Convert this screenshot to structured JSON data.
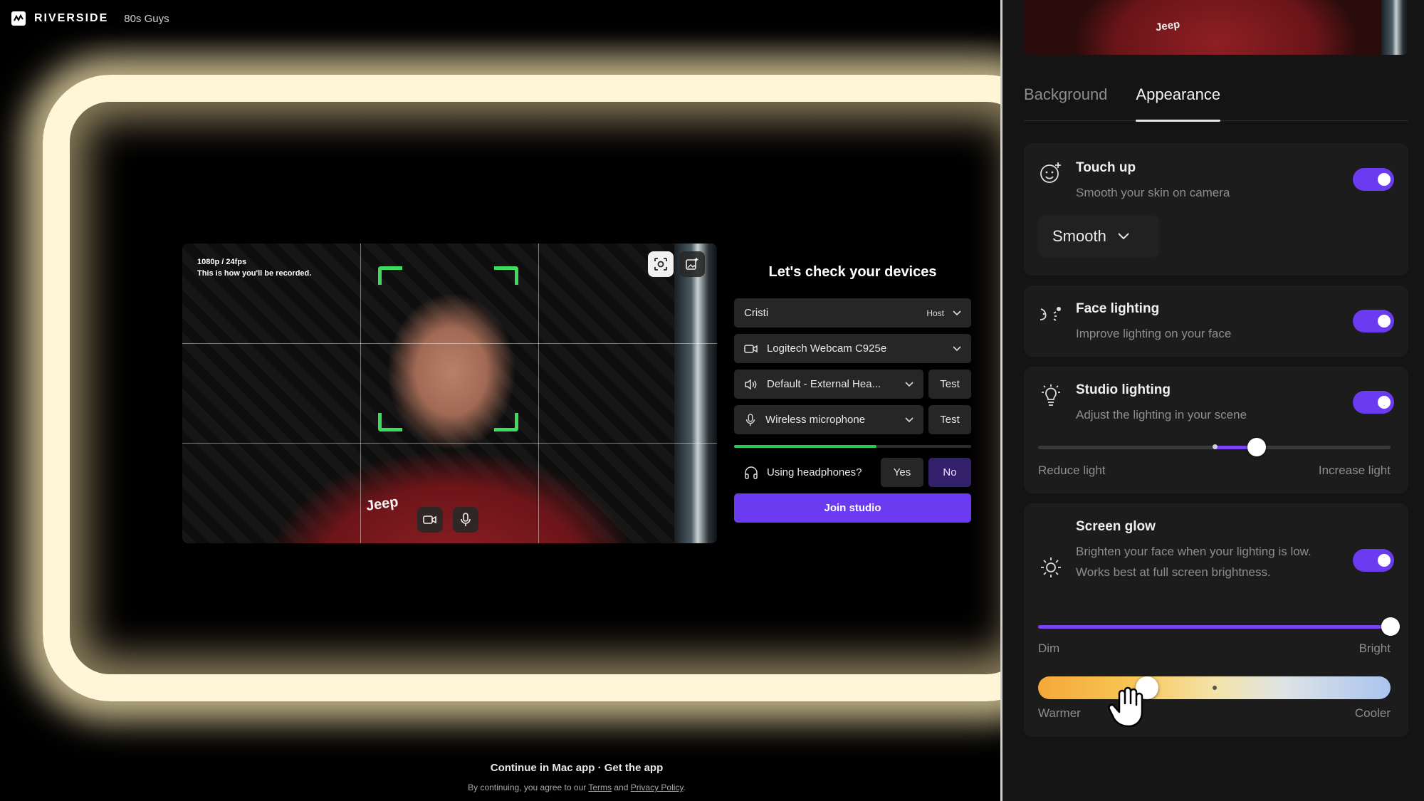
{
  "app": {
    "brand": "RIVERSIDE",
    "session_name": "80s Guys"
  },
  "preview": {
    "resolution": "1080p / 24fps",
    "note": "This is how you'll be recorded.",
    "shirt_logo": "Jeep"
  },
  "devices": {
    "title": "Let's check your devices",
    "name": "Cristi",
    "role": "Host",
    "camera": "Logitech Webcam C925e",
    "speaker": "Default - External Hea...",
    "microphone": "Wireless microphone",
    "test_label": "Test",
    "mic_level": 0.6,
    "headphones_question": "Using headphones?",
    "yes_label": "Yes",
    "no_label": "No",
    "join_label": "Join studio"
  },
  "footer": {
    "continue": "Continue in Mac app",
    "separator": " · ",
    "get_app": "Get the app",
    "legal_prefix": "By continuing, you agree to our ",
    "terms": "Terms",
    "and": " and ",
    "privacy": "Privacy Policy",
    "period": "."
  },
  "panel": {
    "tabs": [
      {
        "label": "Background",
        "active": false
      },
      {
        "label": "Appearance",
        "active": true
      }
    ],
    "touch_up": {
      "title": "Touch up",
      "desc": "Smooth your skin on camera",
      "enabled": true,
      "mode": "Smooth"
    },
    "face_lighting": {
      "title": "Face lighting",
      "desc": "Improve lighting on your face",
      "enabled": true
    },
    "studio_lighting": {
      "title": "Studio lighting",
      "desc": "Adjust the lighting in your scene",
      "enabled": true,
      "value": 0.62,
      "center": 0.5,
      "min_label": "Reduce light",
      "max_label": "Increase light"
    },
    "screen_glow": {
      "title": "Screen glow",
      "desc": "Brighten your face when your lighting is low. Works best at full screen brightness.",
      "enabled": true,
      "brightness": 1.0,
      "brightness_min_label": "Dim",
      "brightness_max_label": "Bright",
      "temperature": 0.31,
      "temperature_center": 0.5,
      "temp_min_label": "Warmer",
      "temp_max_label": "Cooler"
    }
  },
  "colors": {
    "accent": "#6a3bf0",
    "level": "#28c94f",
    "frame": "#3ddc5c",
    "glow": "#fff6d8"
  }
}
